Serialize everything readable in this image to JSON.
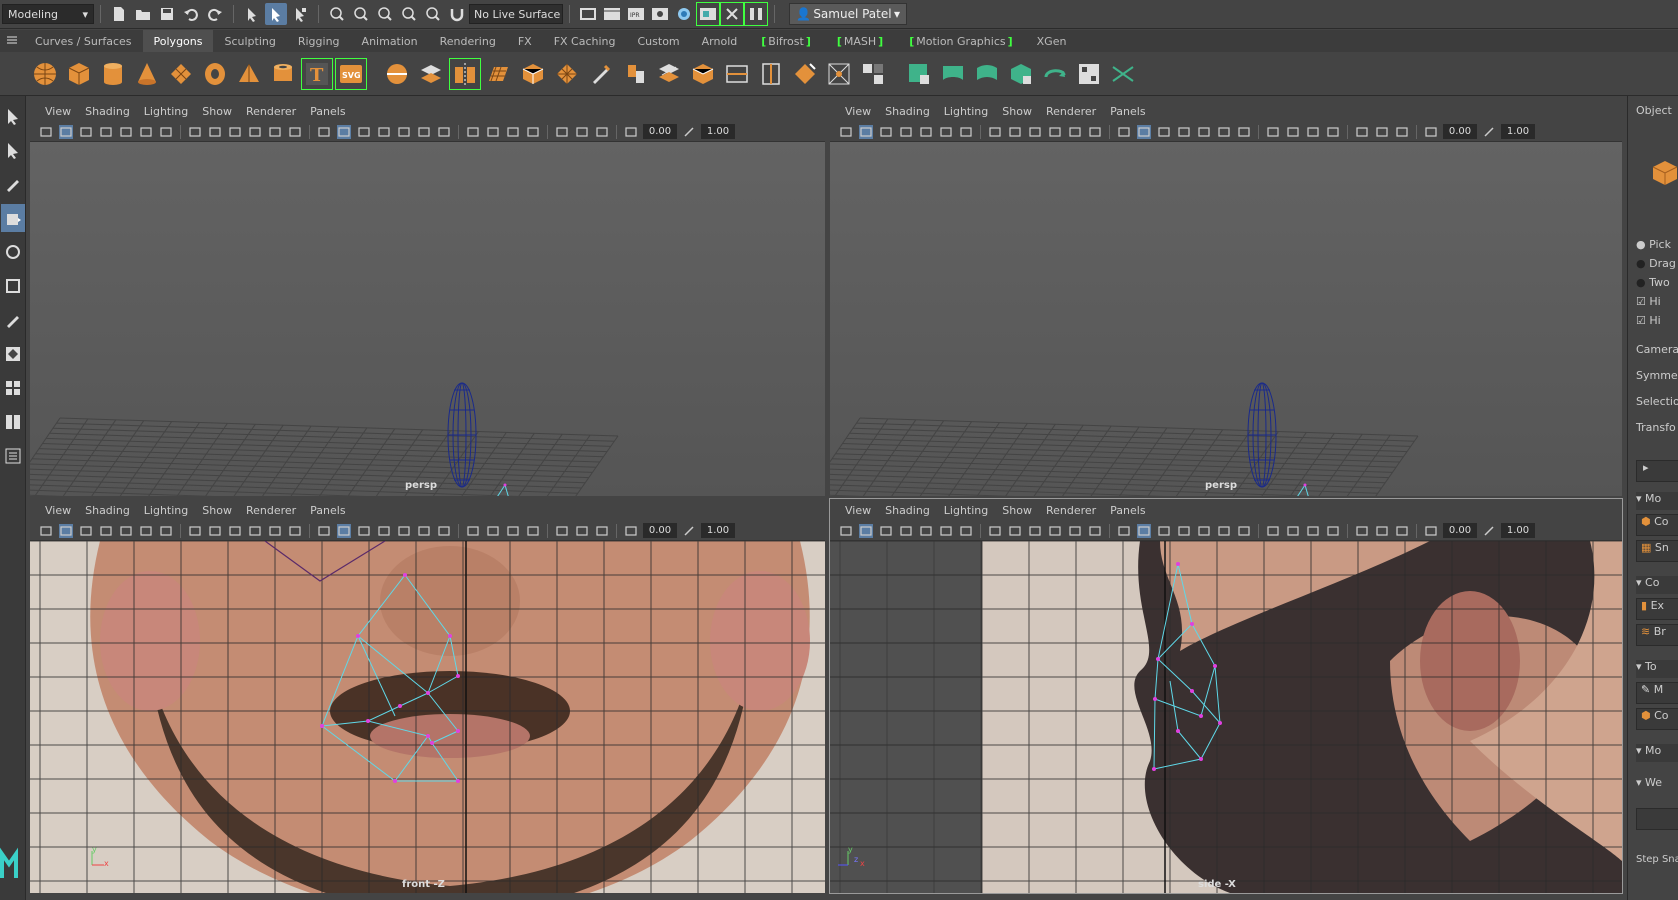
{
  "topbar": {
    "mode_menu": "Modeling",
    "live_surface": "No Live Surface",
    "user_name": "Samuel Patel"
  },
  "shelf_tabs": [
    {
      "label": "Curves / Surfaces"
    },
    {
      "label": "Polygons"
    },
    {
      "label": "Sculpting"
    },
    {
      "label": "Rigging"
    },
    {
      "label": "Animation"
    },
    {
      "label": "Rendering"
    },
    {
      "label": "FX"
    },
    {
      "label": "FX Caching"
    },
    {
      "label": "Custom"
    },
    {
      "label": "Arnold"
    },
    {
      "label": "Bifrost"
    },
    {
      "label": "MASH"
    },
    {
      "label": "Motion Graphics"
    },
    {
      "label": "XGen"
    }
  ],
  "panel_menu": [
    "View",
    "Shading",
    "Lighting",
    "Show",
    "Renderer",
    "Panels"
  ],
  "panel_values": {
    "near": "0.00",
    "far": "1.00"
  },
  "viewports": {
    "top_left_camera": "persp",
    "top_right_camera": "persp",
    "bottom_left_camera": "front -Z",
    "bottom_right_camera": "side -X"
  },
  "axis_labels": {
    "x": "x",
    "y": "y",
    "z": "z"
  },
  "right_panel": {
    "title": "Object",
    "radio_options": [
      "Pick",
      "Drag",
      "Two"
    ],
    "check_options": [
      "Hi",
      "Hi"
    ],
    "sections": [
      "Camera",
      "Symme",
      "Selectio",
      "Transfo"
    ],
    "collapsed_sections": [
      "Mo",
      "Co",
      "To",
      "Mo"
    ],
    "items": [
      "Co",
      "Sn",
      "Ex",
      "Br",
      "M",
      "Co",
      "We"
    ],
    "step_snap": "Step Sna"
  }
}
